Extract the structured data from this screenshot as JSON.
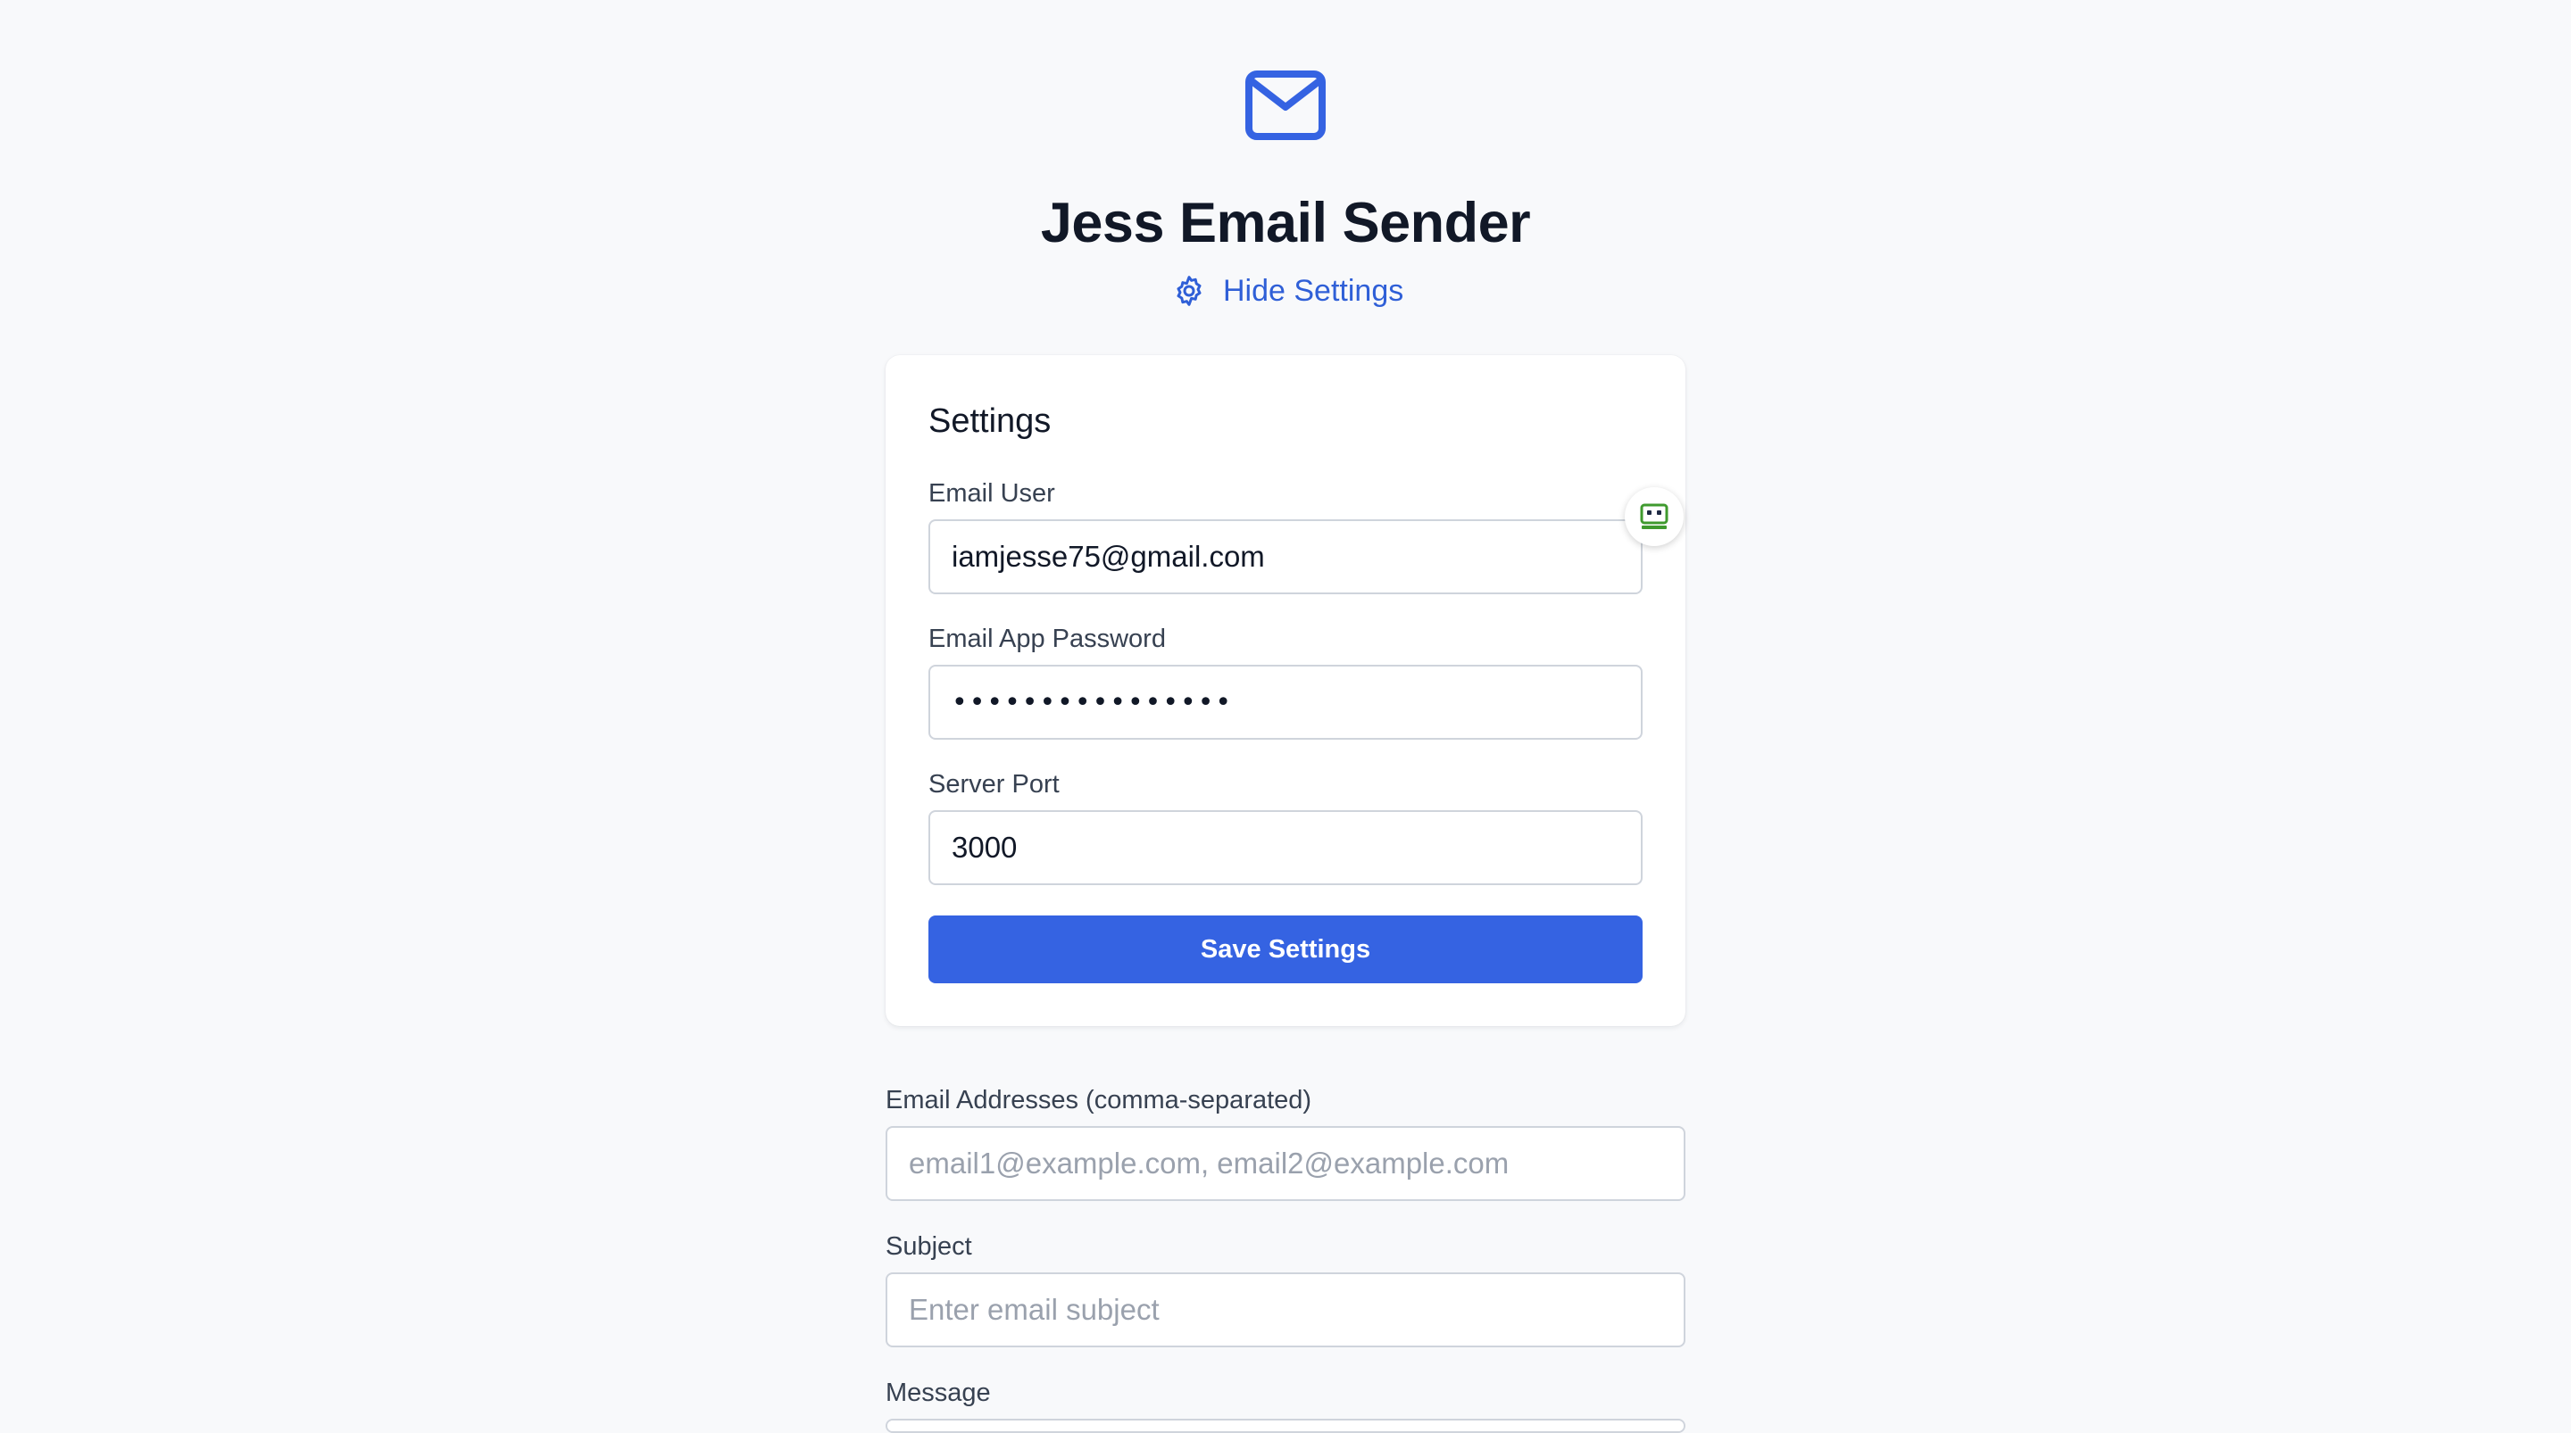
{
  "app": {
    "title": "Jess Email Sender",
    "toggle_settings_label": "Hide Settings",
    "header_icon": "mail-icon",
    "accent_color": "#3563e2"
  },
  "settings": {
    "title": "Settings",
    "email_user": {
      "label": "Email User",
      "value": "iamjesse75@gmail.com"
    },
    "email_app_password": {
      "label": "Email App Password",
      "value": "••••••••••••••••"
    },
    "server_port": {
      "label": "Server Port",
      "value": "3000"
    },
    "save_label": "Save Settings",
    "autofill_icon": "password-manager-icon"
  },
  "compose": {
    "addresses": {
      "label": "Email Addresses (comma-separated)",
      "placeholder": "email1@example.com, email2@example.com"
    },
    "subject": {
      "label": "Subject",
      "placeholder": "Enter email subject"
    },
    "message": {
      "label": "Message"
    }
  }
}
